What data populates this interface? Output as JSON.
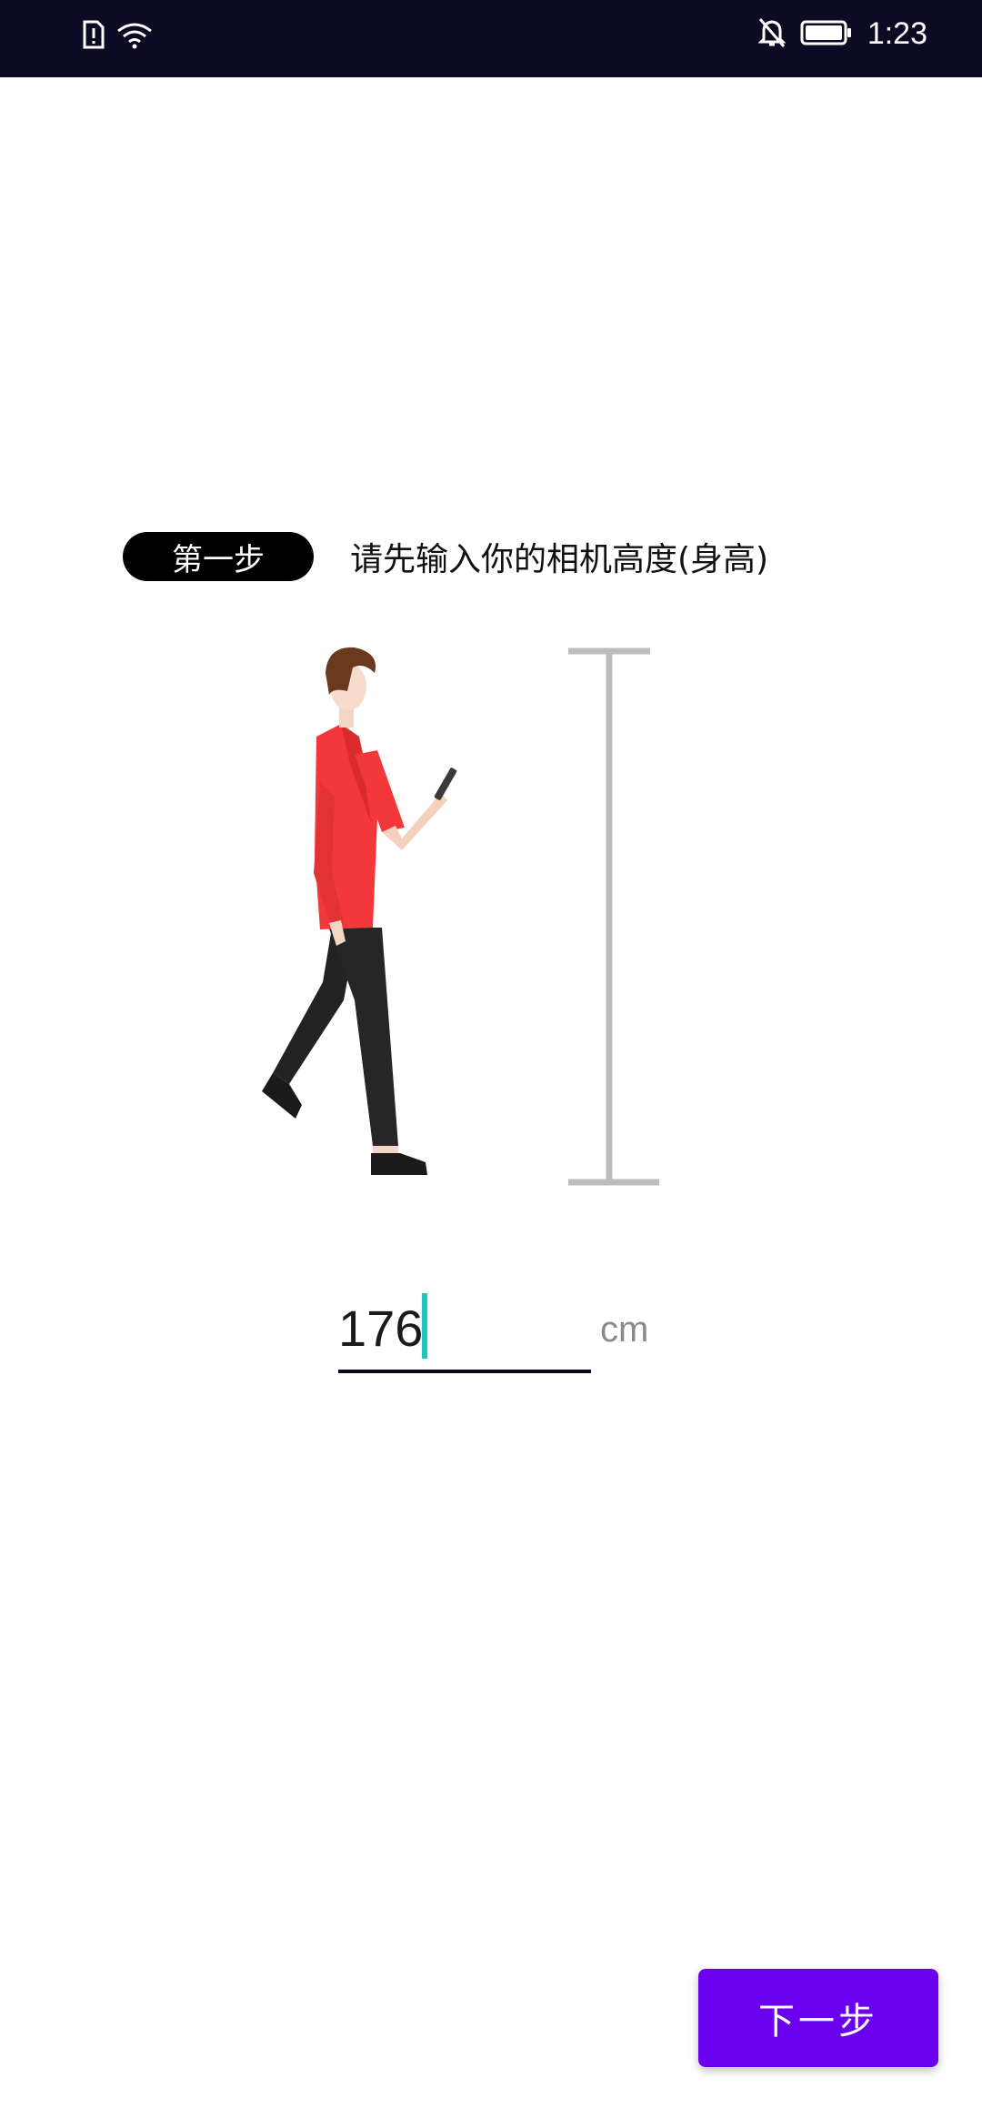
{
  "status_bar": {
    "time": "1:23",
    "icons": [
      "sim-alert-icon",
      "wifi-icon",
      "bell-off-icon",
      "battery-icon"
    ]
  },
  "step": {
    "badge_label": "第一步",
    "instruction": "请先输入你的相机高度(身高)"
  },
  "illustration": {
    "description_icon": "walking-person-with-phone",
    "ruler_icon": "height-ruler"
  },
  "height_input": {
    "value": "176",
    "unit": "cm"
  },
  "actions": {
    "next_label": "下一步"
  },
  "colors": {
    "status_bar_bg": "#0d0b24",
    "accent_purple": "#6a00ee",
    "caret_teal": "#1fc6c0",
    "shirt_red": "#f2383a",
    "ruler_gray": "#bdbdbd"
  }
}
